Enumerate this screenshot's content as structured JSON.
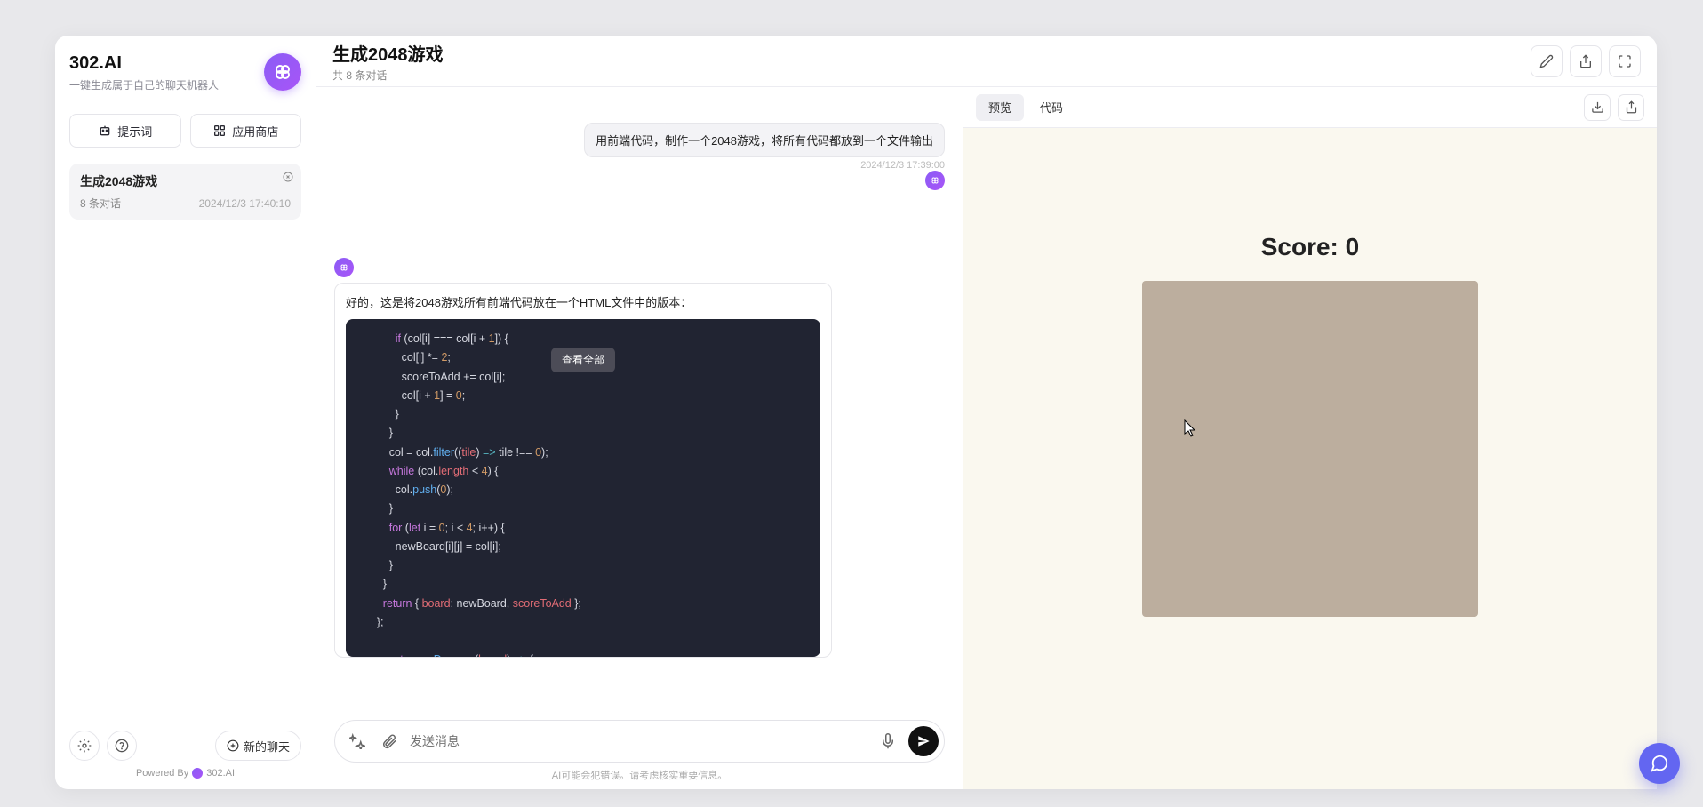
{
  "sidebar": {
    "brand": "302.AI",
    "tagline": "一键生成属于自己的聊天机器人",
    "buttons": {
      "prompts": "提示词",
      "store": "应用商店"
    },
    "conversation": {
      "title": "生成2048游戏",
      "count": "8 条对话",
      "time": "2024/12/3 17:40:10"
    },
    "newChat": "新的聊天",
    "powered": "Powered By",
    "poweredBrand": "302.AI"
  },
  "header": {
    "title": "生成2048游戏",
    "sub": "共 8 条对话"
  },
  "chat": {
    "userMsg": "用前端代码，制作一个2048游戏，将所有代码都放到一个文件输出",
    "userTime": "2024/12/3 17:39:00",
    "aiIntro": "好的，这是将2048游戏所有前端代码放在一个HTML文件中的版本：",
    "viewAll": "查看全部",
    "placeholder": "发送消息",
    "disclaimer": "AI可能会犯错误。请考虑核实重要信息。"
  },
  "preview": {
    "tabPreview": "预览",
    "tabCode": "代码",
    "scoreLabel": "Score:",
    "scoreValue": "0"
  }
}
